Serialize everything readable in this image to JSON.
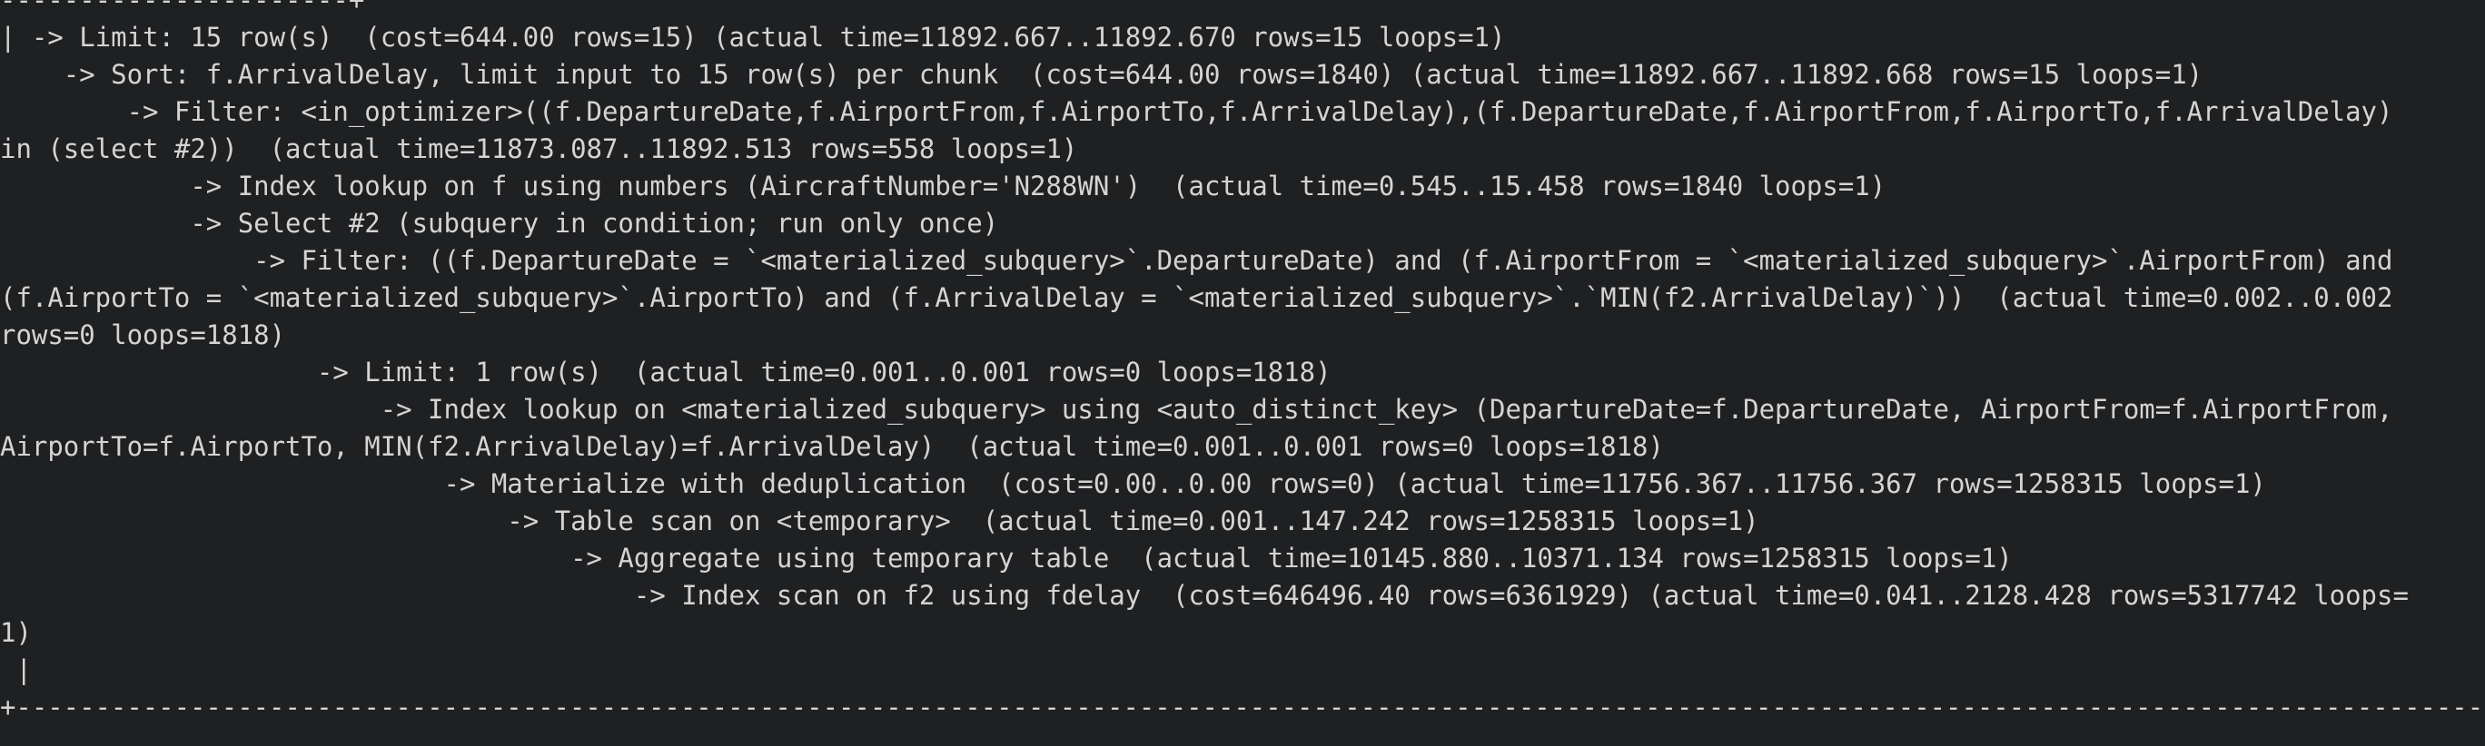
{
  "terminal": {
    "lines": [
      "----------------------+",
      "| -> Limit: 15 row(s)  (cost=644.00 rows=15) (actual time=11892.667..11892.670 rows=15 loops=1)",
      "    -> Sort: f.ArrivalDelay, limit input to 15 row(s) per chunk  (cost=644.00 rows=1840) (actual time=11892.667..11892.668 rows=15 loops=1)",
      "        -> Filter: <in_optimizer>((f.DepartureDate,f.AirportFrom,f.AirportTo,f.ArrivalDelay),(f.DepartureDate,f.AirportFrom,f.AirportTo,f.ArrivalDelay)",
      "in (select #2))  (actual time=11873.087..11892.513 rows=558 loops=1)",
      "            -> Index lookup on f using numbers (AircraftNumber='N288WN')  (actual time=0.545..15.458 rows=1840 loops=1)",
      "            -> Select #2 (subquery in condition; run only once)",
      "                -> Filter: ((f.DepartureDate = `<materialized_subquery>`.DepartureDate) and (f.AirportFrom = `<materialized_subquery>`.AirportFrom) and",
      "(f.AirportTo = `<materialized_subquery>`.AirportTo) and (f.ArrivalDelay = `<materialized_subquery>`.`MIN(f2.ArrivalDelay)`))  (actual time=0.002..0.002",
      "rows=0 loops=1818)",
      "                    -> Limit: 1 row(s)  (actual time=0.001..0.001 rows=0 loops=1818)",
      "                        -> Index lookup on <materialized_subquery> using <auto_distinct_key> (DepartureDate=f.DepartureDate, AirportFrom=f.AirportFrom,",
      "AirportTo=f.AirportTo, MIN(f2.ArrivalDelay)=f.ArrivalDelay)  (actual time=0.001..0.001 rows=0 loops=1818)",
      "                            -> Materialize with deduplication  (cost=0.00..0.00 rows=0) (actual time=11756.367..11756.367 rows=1258315 loops=1)",
      "                                -> Table scan on <temporary>  (actual time=0.001..147.242 rows=1258315 loops=1)",
      "                                    -> Aggregate using temporary table  (actual time=10145.880..10371.134 rows=1258315 loops=1)",
      "                                        -> Index scan on f2 using fdelay  (cost=646496.40 rows=6361929) (actual time=0.041..2128.428 rows=5317742 loops=",
      "1)",
      " |",
      "+------------------------------------------------------------------------------------------------------------------------------------------------------------"
    ]
  }
}
